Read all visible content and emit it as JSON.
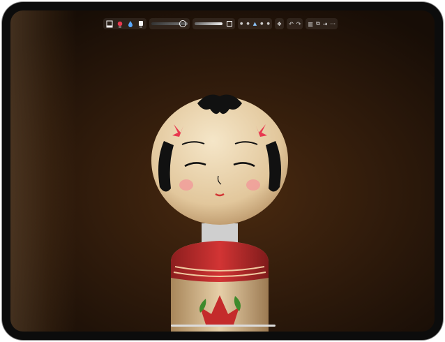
{
  "app": {
    "accent_color": "#e8384f"
  },
  "toolbar": {
    "tools": [
      {
        "name": "eraser-tool",
        "icon": "eraser-icon"
      },
      {
        "name": "paint-tool",
        "icon": "paint-drop-icon",
        "color": "#e8384f"
      },
      {
        "name": "blur-tool",
        "icon": "water-drop-icon",
        "color": "#5aa9ff"
      },
      {
        "name": "white-tool",
        "icon": "white-swatch-icon"
      }
    ],
    "brush_size_level": 0.85,
    "opacity_level": 0.55,
    "selected_segment": "blur",
    "actions": [
      {
        "name": "layers",
        "icon": "layers-icon"
      },
      {
        "name": "undo",
        "icon": "undo-icon"
      },
      {
        "name": "redo",
        "icon": "redo-icon"
      },
      {
        "name": "delete",
        "icon": "trash-icon"
      },
      {
        "name": "gallery",
        "icon": "gallery-icon"
      },
      {
        "name": "export",
        "icon": "export-icon"
      },
      {
        "name": "more",
        "icon": "more-icon"
      }
    ]
  },
  "subject": {
    "body_red": "#c42b2b",
    "face_wood": "#e9d2ad",
    "leaf_green": "#3e8a2c"
  }
}
